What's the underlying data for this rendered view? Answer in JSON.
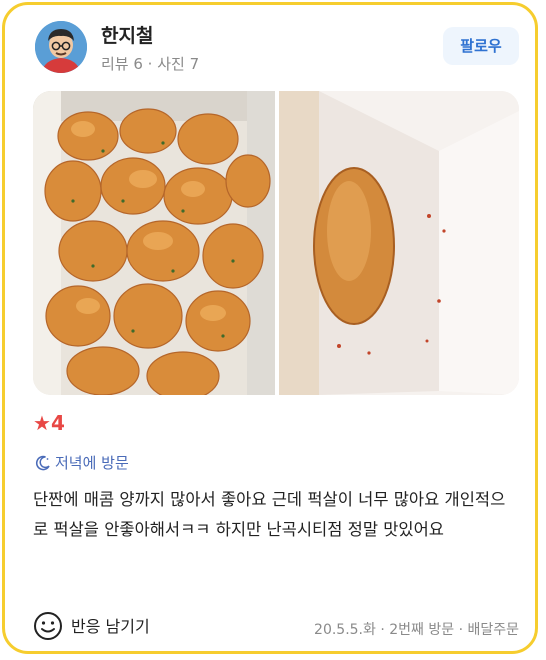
{
  "user": {
    "name": "한지철",
    "stats": "리뷰 6 · 사진 7"
  },
  "follow_label": "팔로우",
  "photos": [
    {
      "icon": "fried-chicken-photo"
    },
    {
      "icon": "croquette-in-box-photo"
    }
  ],
  "rating": {
    "star": "★",
    "value": "4"
  },
  "visit_time": "저녁에 방문",
  "review_text": "단짠에 매콤 양까지 많아서 좋아요 근데 퍽살이 너무 많아요 개인적으로 퍽살을 안좋아해서ㅋㅋ 하지만 난곡시티점 정말 맛있어요",
  "footer": {
    "react_label": "반응 남기기",
    "meta": "20.5.5.화 · 2번째 방문 · 배달주문"
  },
  "colors": {
    "card_border": "#f6cd2e",
    "accent_blue": "#2f72d1",
    "star_red": "#e84845"
  }
}
